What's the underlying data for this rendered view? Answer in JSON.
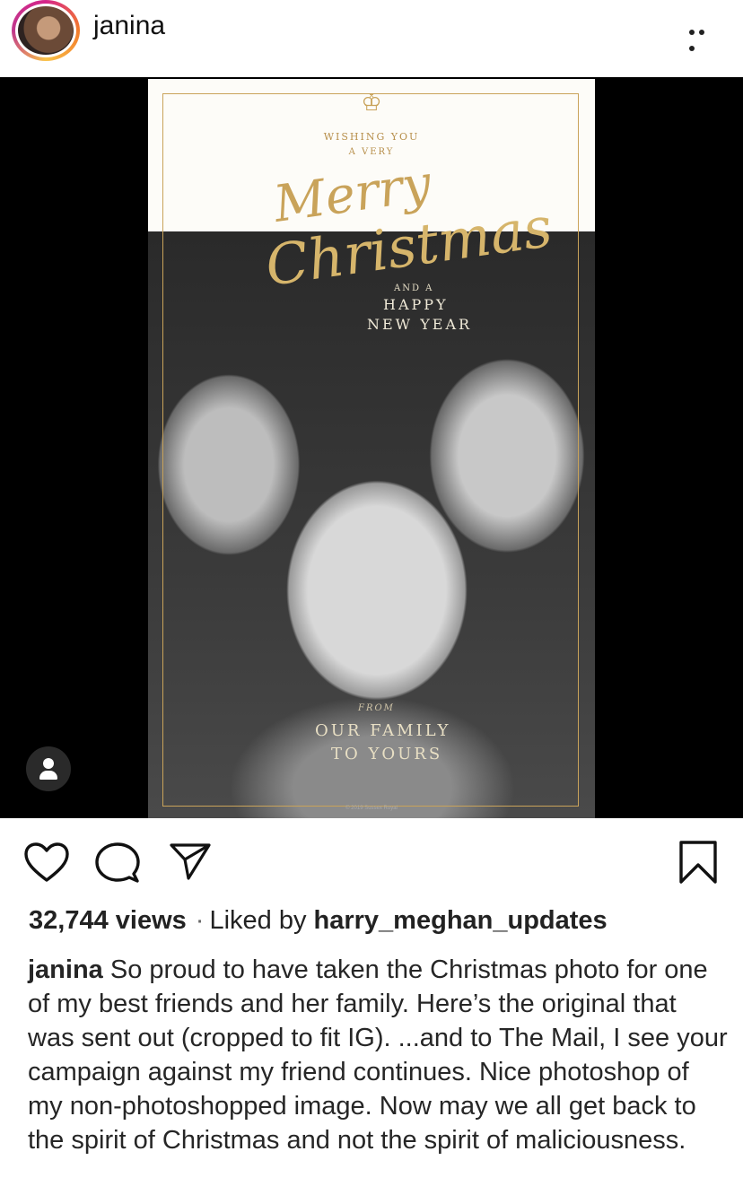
{
  "post": {
    "username": "janina",
    "more_icon": "more-horizontal-icon",
    "tag_icon": "person-icon"
  },
  "card": {
    "wishing": "WISHING YOU",
    "a_very": "A VERY",
    "merry": "Merry",
    "christmas": "Christmas",
    "and_a": "AND A",
    "happy": "HAPPY",
    "new_year": "NEW YEAR",
    "from": "FROM",
    "our_family": "OUR FAMILY",
    "to_yours": "TO YOURS",
    "copyright": "© 2019 Sussex Royal"
  },
  "actions": {
    "like_icon": "heart-icon",
    "comment_icon": "comment-icon",
    "share_icon": "paper-plane-icon",
    "save_icon": "bookmark-icon"
  },
  "stats": {
    "views": "32,744 views",
    "separator": "·",
    "liked_by_prefix": "Liked by",
    "liked_by_user": "harry_meghan_updates"
  },
  "caption": {
    "username": "janina",
    "text": "So proud to have taken the Christmas photo for one of my best friends and her family. Here’s the original that was sent out (cropped to fit IG). ...and to The Mail, I see your campaign against my friend continues. Nice photoshop of my non-photoshopped image. Now may we all get back to the spirit of Christmas and not the spirit of maliciousness."
  }
}
